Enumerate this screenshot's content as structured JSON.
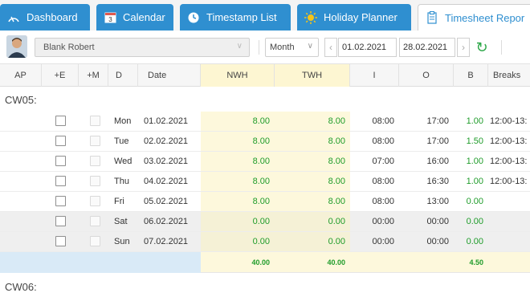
{
  "tabs": [
    {
      "label": "Dashboard",
      "icon": "dashboard-gauge-icon"
    },
    {
      "label": "Calendar",
      "icon": "calendar-icon",
      "icon_text": "3"
    },
    {
      "label": "Timestamp List",
      "icon": "clock-icon"
    },
    {
      "label": "Holiday Planner",
      "icon": "sun-icon"
    },
    {
      "label": "Timesheet Repor",
      "icon": "report-document-icon",
      "active": true
    }
  ],
  "toolbar": {
    "employee": "Blank Robert",
    "period": "Month",
    "date_from": "01.02.2021",
    "date_to": "28.02.2021",
    "prev": "‹",
    "next": "›",
    "chev": "∨",
    "refresh": "↻"
  },
  "columns": [
    "AP",
    "+E",
    "+M",
    "D",
    "Date",
    "NWH",
    "TWH",
    "I",
    "O",
    "B",
    "Breaks"
  ],
  "groups": [
    {
      "label": "CW05:",
      "rows": [
        {
          "day": "Mon",
          "date": "01.02.2021",
          "nwh": "8.00",
          "twh": "8.00",
          "in": "08:00",
          "out": "17:00",
          "b": "1.00",
          "breaks": "12:00-13:",
          "weekend": false
        },
        {
          "day": "Tue",
          "date": "02.02.2021",
          "nwh": "8.00",
          "twh": "8.00",
          "in": "08:00",
          "out": "17:00",
          "b": "1.50",
          "breaks": "12:00-13:",
          "weekend": false
        },
        {
          "day": "Wed",
          "date": "03.02.2021",
          "nwh": "8.00",
          "twh": "8.00",
          "in": "07:00",
          "out": "16:00",
          "b": "1.00",
          "breaks": "12:00-13:",
          "weekend": false
        },
        {
          "day": "Thu",
          "date": "04.02.2021",
          "nwh": "8.00",
          "twh": "8.00",
          "in": "08:00",
          "out": "16:30",
          "b": "1.00",
          "breaks": "12:00-13:",
          "weekend": false
        },
        {
          "day": "Fri",
          "date": "05.02.2021",
          "nwh": "8.00",
          "twh": "8.00",
          "in": "08:00",
          "out": "13:00",
          "b": "0.00",
          "breaks": "",
          "weekend": false
        },
        {
          "day": "Sat",
          "date": "06.02.2021",
          "nwh": "0.00",
          "twh": "0.00",
          "in": "00:00",
          "out": "00:00",
          "b": "0.00",
          "breaks": "",
          "weekend": true
        },
        {
          "day": "Sun",
          "date": "07.02.2021",
          "nwh": "0.00",
          "twh": "0.00",
          "in": "00:00",
          "out": "00:00",
          "b": "0.00",
          "breaks": "",
          "weekend": true
        }
      ],
      "totals": {
        "nwh": "40.00",
        "twh": "40.00",
        "b": "4.50"
      }
    },
    {
      "label": "CW06:",
      "rows": []
    }
  ],
  "colors": {
    "tab_blue": "#2f8fd0",
    "value_green": "#1f9c2a",
    "highlight_yellow": "#fdf8dc",
    "total_blue": "#d9eaf7"
  }
}
